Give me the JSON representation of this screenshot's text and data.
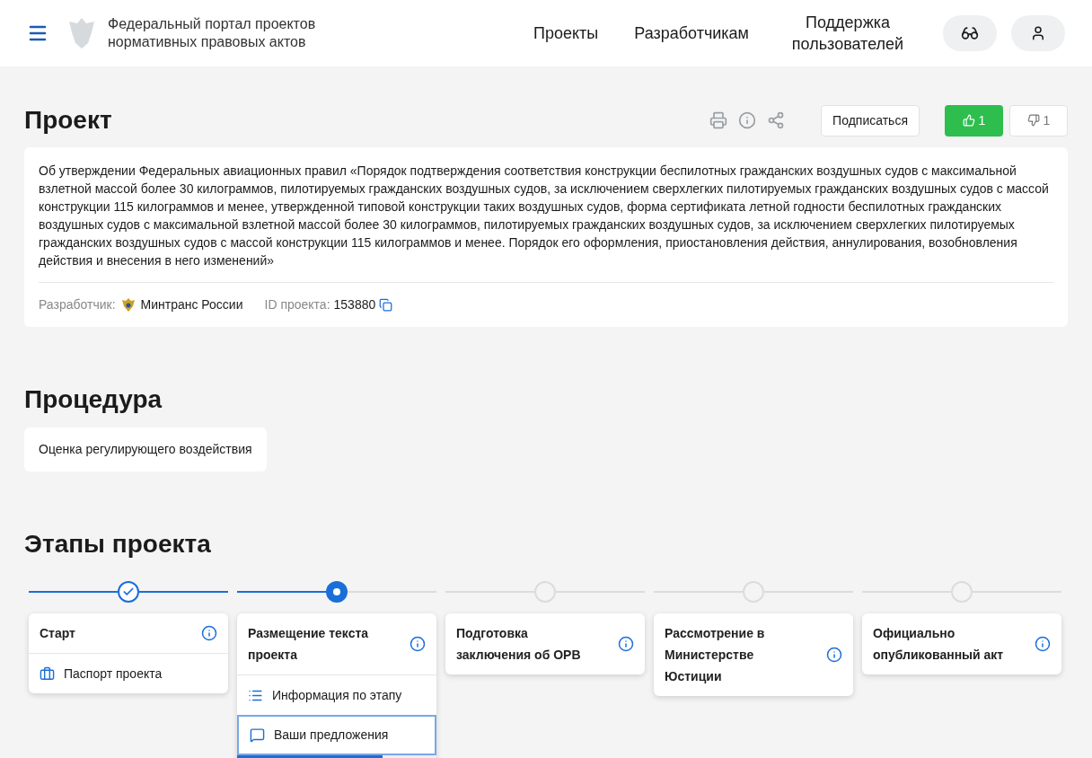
{
  "header": {
    "site_title": "Федеральный портал проектов нормативных правовых актов",
    "nav": [
      "Проекты",
      "Разработчикам",
      "Поддержка пользователей"
    ]
  },
  "project": {
    "heading": "Проект",
    "subscribe": "Подписаться",
    "likes": "1",
    "dislikes": "1",
    "description": "Об утверждении Федеральных авиационных правил «Порядок подтверждения соответствия конструкции беспилотных гражданских воздушных судов с максимальной взлетной массой более 30 килограммов, пилотируемых гражданских воздушных судов, за исключением сверхлегких пилотируемых гражданских воздушных судов с массой конструкции 115 килограммов и менее, утвержденной типовой конструкции таких воздушных судов, форма сертификата летной годности беспилотных гражданских воздушных судов с максимальной взлетной массой более 30 килограммов, пилотируемых гражданских воздушных судов, за исключением сверхлегких пилотируемых гражданских воздушных судов с массой конструкции 115 килограммов и менее. Порядок его оформления, приостановления действия, аннулирования, возобновления действия и внесения в него изменений»",
    "developer_label": "Разработчик:",
    "developer": "Минтранс России",
    "id_label": "ID проекта:",
    "id": "153880"
  },
  "procedure": {
    "heading": "Процедура",
    "value": "Оценка регулирующего воздействия"
  },
  "stages": {
    "heading": "Этапы проекта",
    "items": [
      {
        "title": "Старт",
        "kind": "done",
        "links": [
          {
            "kind": "passport",
            "label": "Паспорт проекта",
            "selected": false
          }
        ]
      },
      {
        "title": "Размещение текста проекта",
        "kind": "current",
        "level": 0.73,
        "links": [
          {
            "kind": "info",
            "label": "Информация по этапу",
            "selected": false
          },
          {
            "kind": "comments",
            "label": "Ваши предложения",
            "selected": true
          }
        ]
      },
      {
        "title": "Подготовка заключения об ОРВ",
        "kind": "pending"
      },
      {
        "title": "Рассмотрение в Министерстве Юстиции",
        "kind": "pending"
      },
      {
        "title": "Официально опубликованный акт",
        "kind": "pending"
      }
    ]
  }
}
